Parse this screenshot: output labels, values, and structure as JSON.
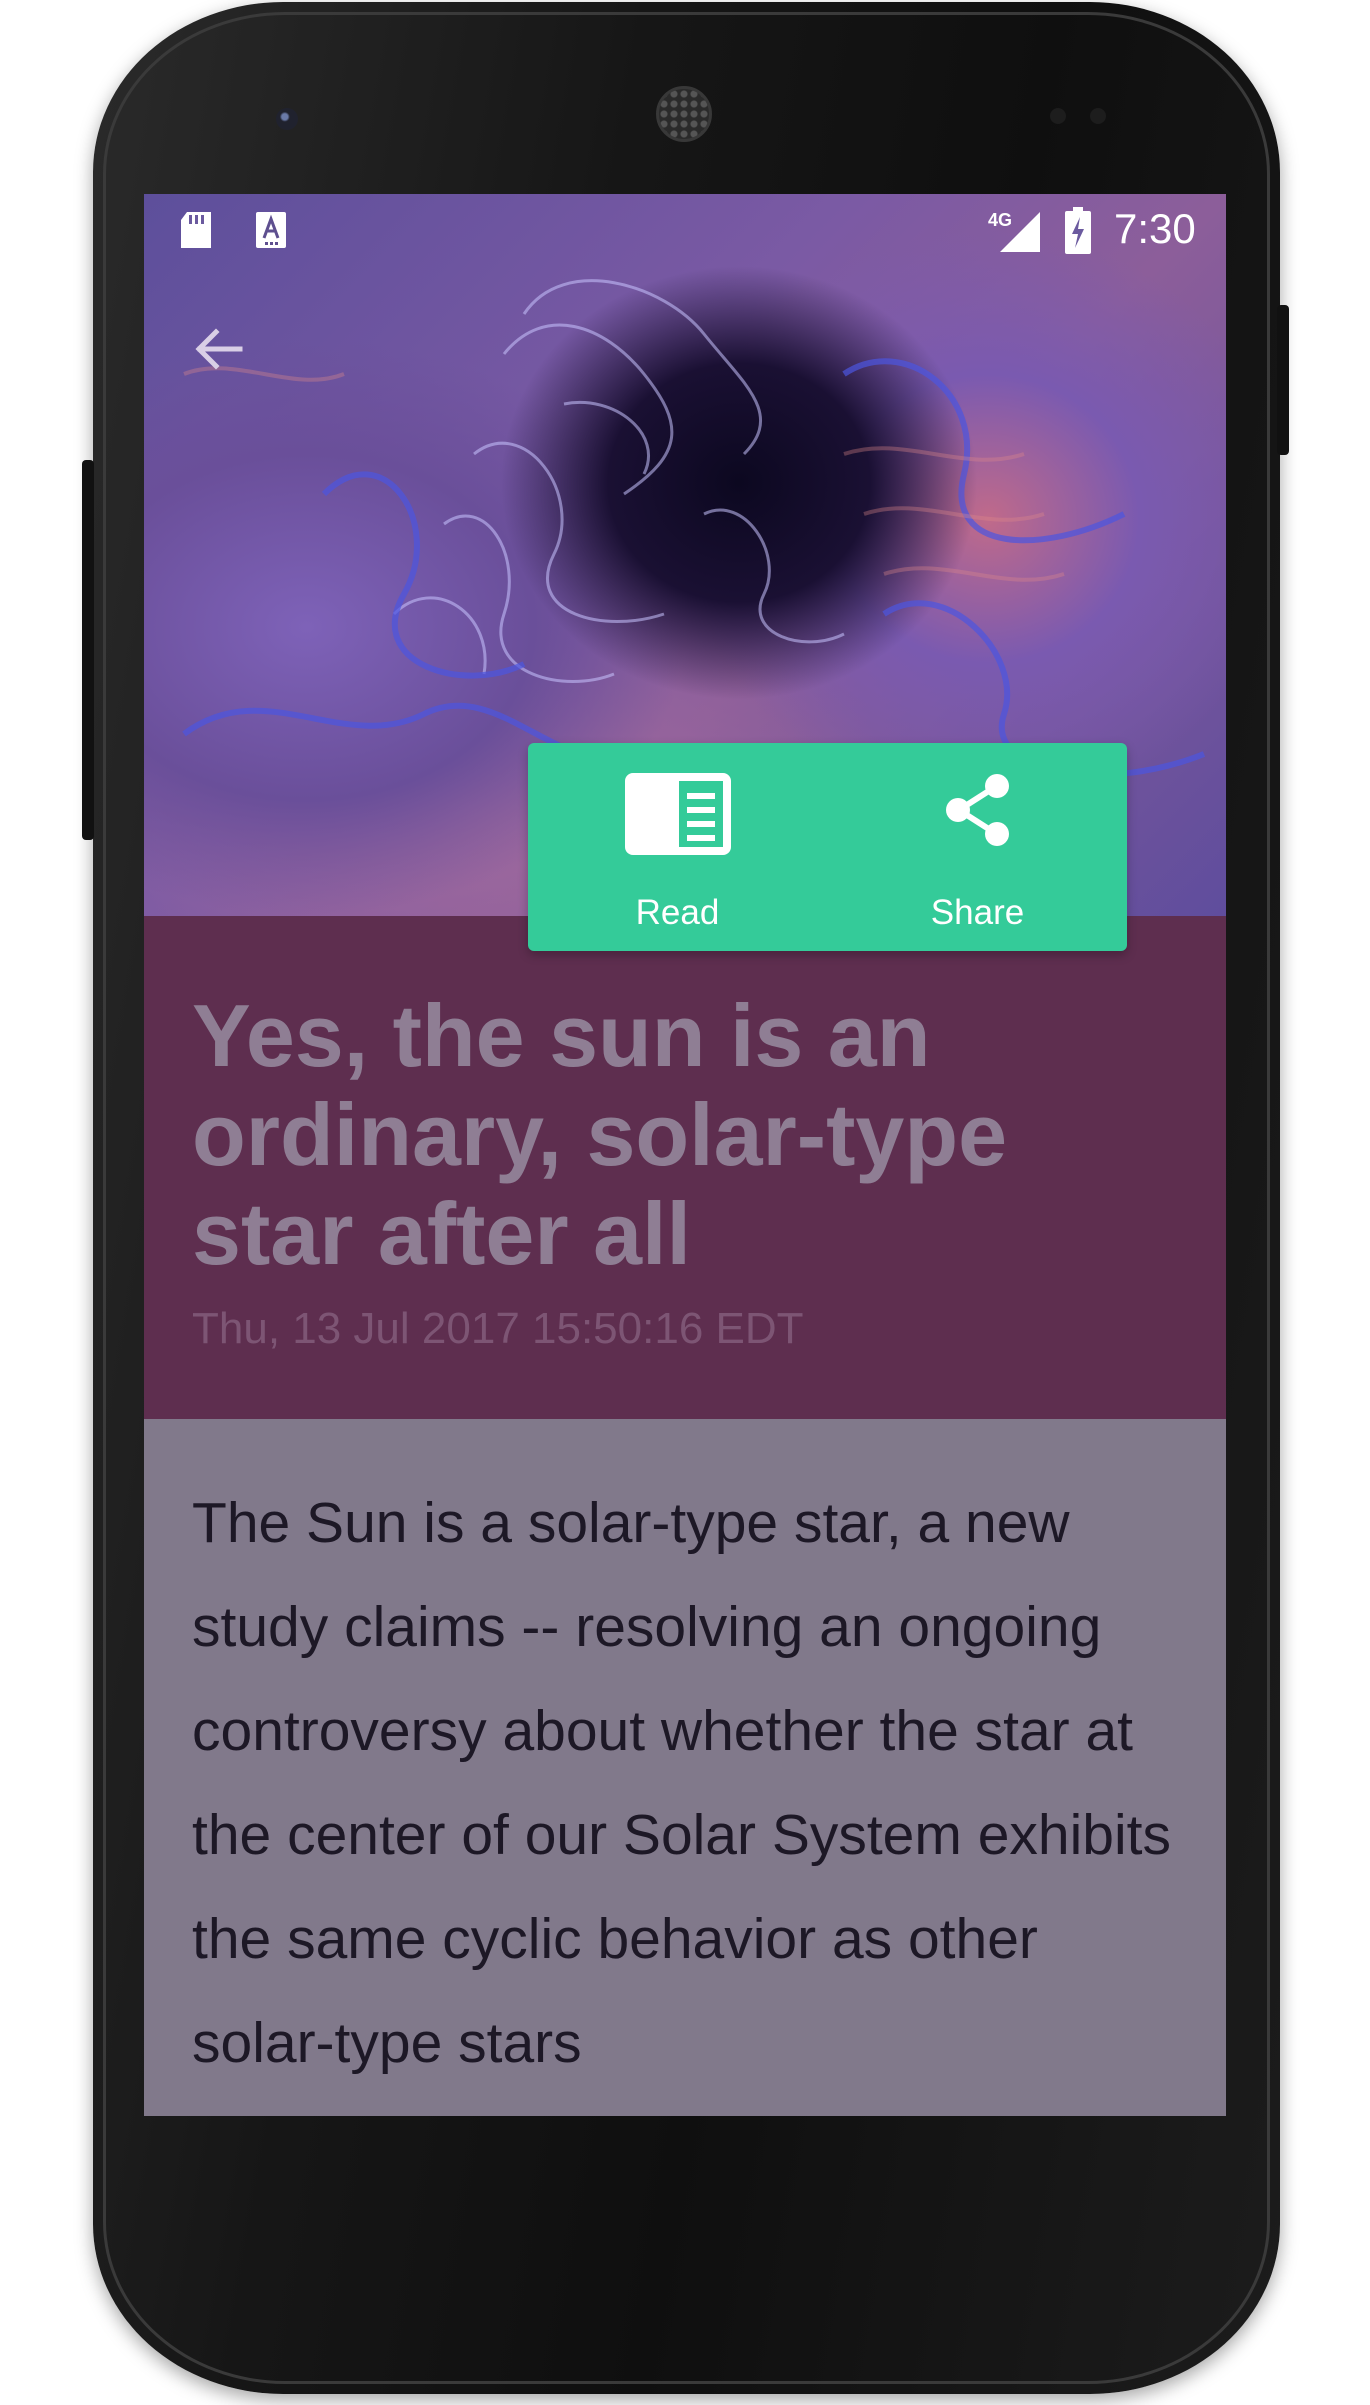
{
  "status_bar": {
    "time": "7:30",
    "network": "4G",
    "icons": [
      "sd-card-icon",
      "font-a-icon",
      "signal-icon",
      "battery-charging-icon"
    ]
  },
  "toolbar": {
    "back_icon": "arrow-back-icon"
  },
  "article": {
    "title": "Yes, the sun is an ordinary, solar-type star after all",
    "date": "Thu, 13 Jul 2017 15:50:16 EDT",
    "body": "The Sun is a solar-type star, a new study claims -- resolving an ongoing controversy about whether the star at the center of our Solar System exhibits the same cyclic behavior as other solar-type stars"
  },
  "actions": {
    "read_label": "Read",
    "read_icon": "reader-icon",
    "share_label": "Share",
    "share_icon": "share-icon"
  },
  "colors": {
    "accent": "#34CB99",
    "header_background": "#5E2E4F",
    "title_text": "#8F7E94",
    "date_text": "#7D5574",
    "body_background": "#81798B",
    "body_text": "#1D1826"
  }
}
